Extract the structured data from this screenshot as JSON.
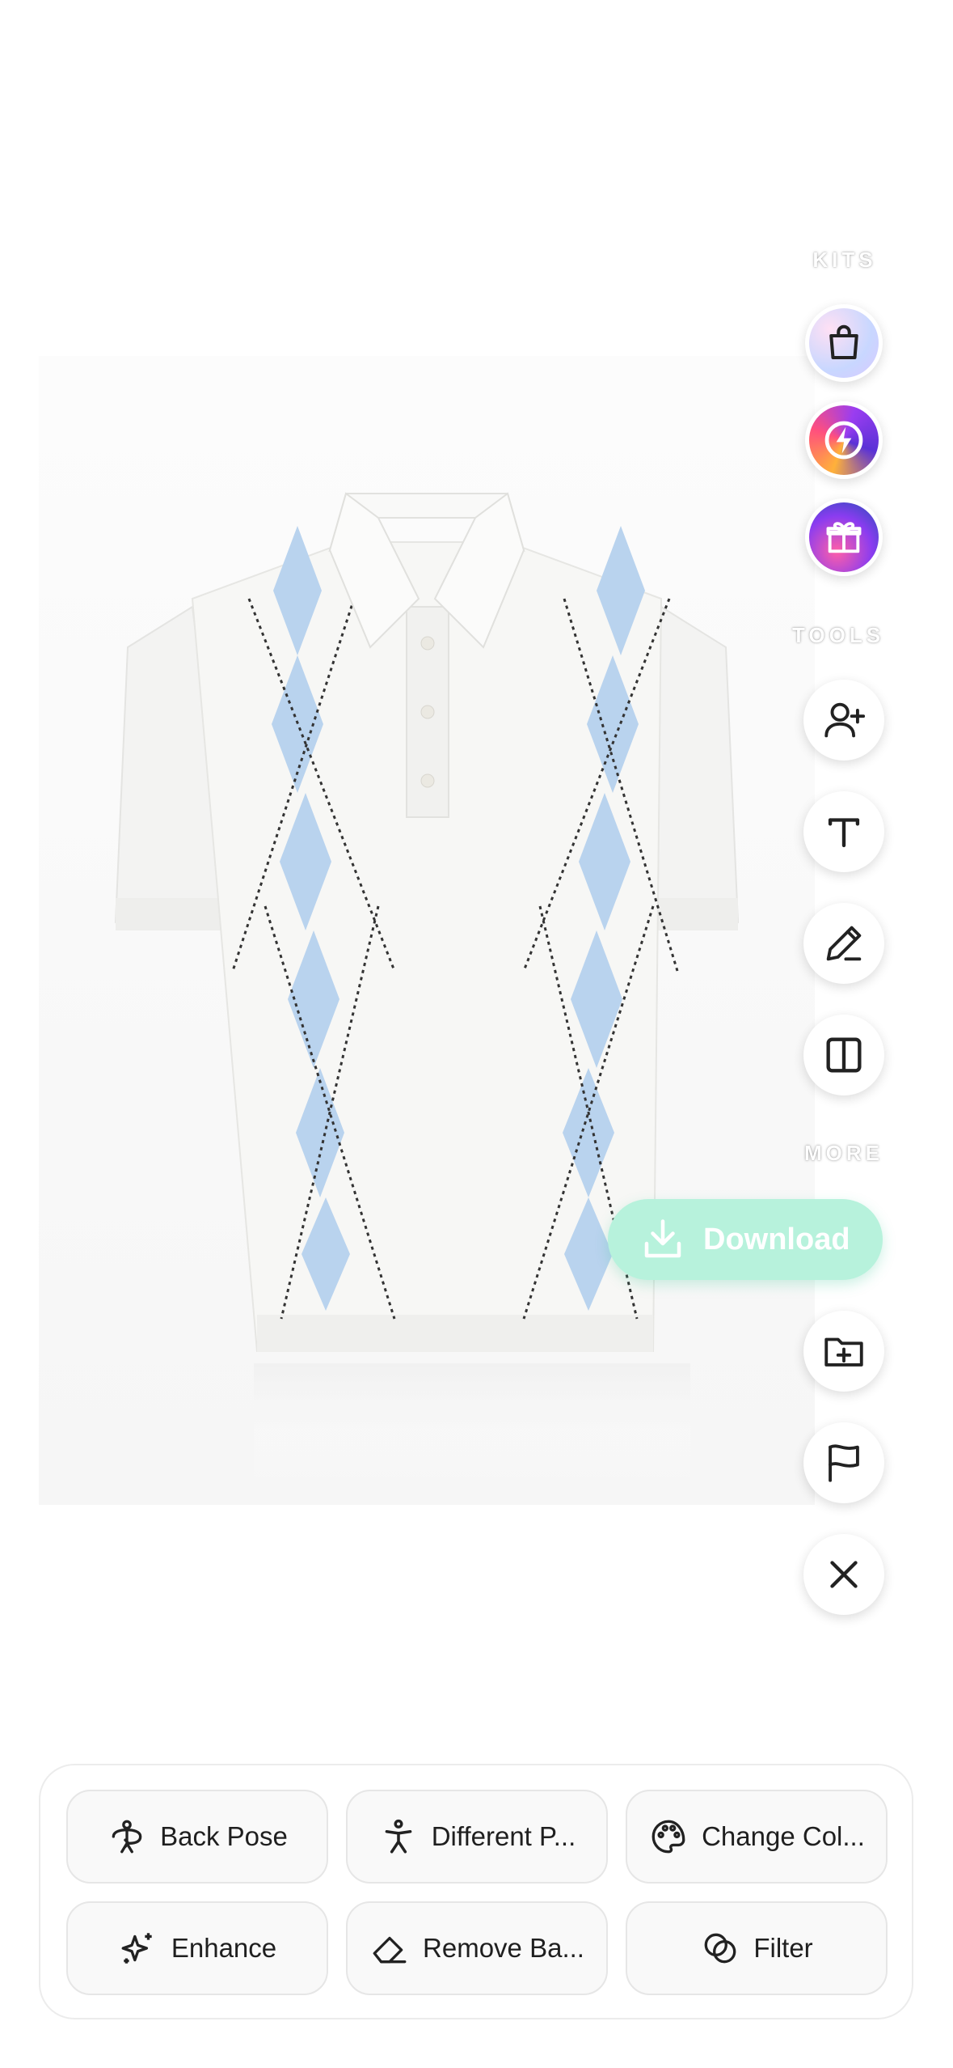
{
  "right_rail": {
    "kits_label": "KITS",
    "kits": [
      {
        "icon": "shopping-bag-icon"
      },
      {
        "icon": "lightning-bolt-icon"
      },
      {
        "icon": "gift-icon"
      }
    ],
    "tools_label": "TOOLS",
    "tools": [
      {
        "icon": "add-person-icon"
      },
      {
        "icon": "text-icon"
      },
      {
        "icon": "pencil-icon"
      },
      {
        "icon": "split-panel-icon"
      }
    ],
    "more_label": "MORE",
    "download_label": "Download",
    "more_actions": [
      {
        "icon": "folder-add-icon"
      },
      {
        "icon": "flag-icon"
      },
      {
        "icon": "close-icon"
      }
    ]
  },
  "actions": {
    "row1": [
      {
        "label": "Back Pose",
        "icon": "rotate-person-icon"
      },
      {
        "label": "Different P...",
        "icon": "person-pose-icon"
      },
      {
        "label": "Change Col...",
        "icon": "palette-icon"
      }
    ],
    "row2": [
      {
        "label": "Enhance",
        "icon": "sparkle-icon"
      },
      {
        "label": "Remove Ba...",
        "icon": "eraser-icon"
      },
      {
        "label": "Filter",
        "icon": "filter-circles-icon"
      }
    ]
  },
  "colors": {
    "download_bg": "#b7f2dc",
    "argyle_blue": "#b9d3ee"
  }
}
